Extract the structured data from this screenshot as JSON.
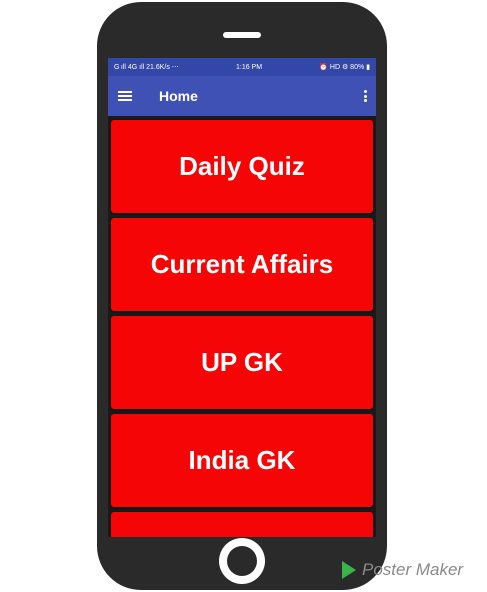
{
  "status_bar": {
    "left": "G ıll 4G ıll 21.6K/s ⋯",
    "time": "1:16 PM",
    "right": "⏰ HD ⚙ 80% ▮"
  },
  "app_bar": {
    "title": "Home"
  },
  "items": [
    {
      "label": "Daily Quiz"
    },
    {
      "label": "Current Affairs"
    },
    {
      "label": "UP GK"
    },
    {
      "label": "India GK"
    },
    {
      "label": ""
    }
  ],
  "watermark": {
    "text": "Poster Maker"
  },
  "colors": {
    "tile": "#f50505",
    "app_bar": "#3f51b5",
    "status_bar": "#3347a8",
    "device": "#2a2a2a"
  }
}
